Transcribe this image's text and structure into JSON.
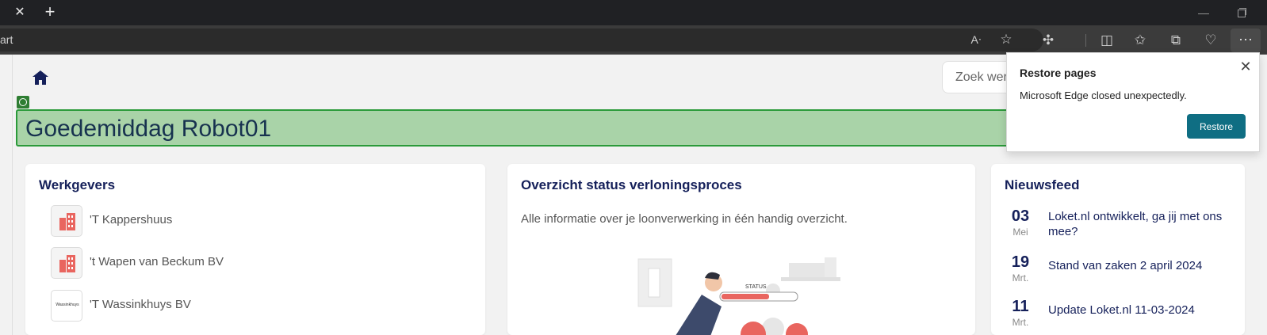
{
  "browser": {
    "address_text": "art",
    "tab_close": "✕",
    "new_tab": "+",
    "minimize": "—",
    "more": "···"
  },
  "page": {
    "search_placeholder": "Zoek werk",
    "greeting": "Goedemiddag Robot01",
    "werkgevers": {
      "title": "Werkgevers",
      "items": [
        {
          "name": "'T Kappershuus"
        },
        {
          "name": "'t Wapen van Beckum BV"
        },
        {
          "name": "'T Wassinkhuys BV",
          "logo_text": "Wassinkhuys"
        }
      ]
    },
    "status": {
      "title": "Overzicht status verloningsproces",
      "description": "Alle informatie over je loonverwerking in één handig overzicht.",
      "illustration_label": "STATUS"
    },
    "news": {
      "title": "Nieuwsfeed",
      "items": [
        {
          "day": "03",
          "month": "Mei",
          "title": "Loket.nl ontwikkelt, ga jij met ons mee?"
        },
        {
          "day": "19",
          "month": "Mrt.",
          "title": "Stand van zaken 2 april 2024"
        },
        {
          "day": "11",
          "month": "Mrt.",
          "title": "Update Loket.nl 11-03-2024"
        }
      ]
    }
  },
  "popup": {
    "title": "Restore pages",
    "message": "Microsoft Edge closed unexpectedly.",
    "button": "Restore"
  },
  "colors": {
    "accent": "#15205a",
    "greeting_band": "#a9d3a8",
    "restore_button": "#0f6e83",
    "logo_red": "#e9655f"
  }
}
